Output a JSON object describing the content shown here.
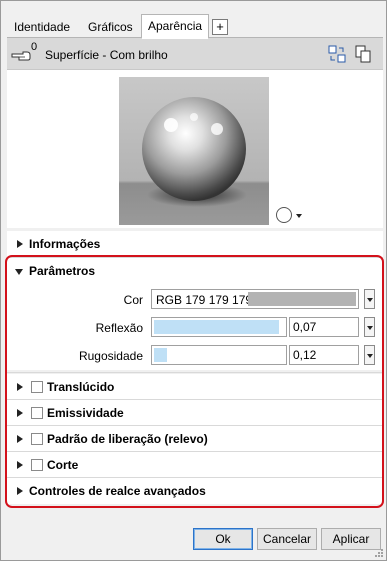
{
  "tabs": [
    {
      "label": "Identidade",
      "active": false
    },
    {
      "label": "Gráficos",
      "active": false
    },
    {
      "label": "Aparência",
      "active": true
    }
  ],
  "tab_add_label": "+",
  "header": {
    "count": "0",
    "title": "Superfície - Com brilho",
    "icons": [
      "hand-icon",
      "replace-asset-icon",
      "duplicate-asset-icon"
    ]
  },
  "preview": {
    "scene_icons": [
      "sphere-scene-icon",
      "chevron-down-icon"
    ]
  },
  "sections": {
    "informacoes": "Informações",
    "parametros": "Parâmetros",
    "translucido": "Translúcido",
    "emissividade": "Emissividade",
    "padrao": "Padrão de liberação (relevo)",
    "corte": "Corte",
    "controles": "Controles de realce avançados"
  },
  "parameters": {
    "cor_label": "Cor",
    "cor_value": "RGB 179 179 179",
    "cor_hex": "#b3b3b3",
    "reflexao_label": "Reflexão",
    "reflexao_value": "0,07",
    "reflexao_fill": 0.95,
    "rugosidade_label": "Rugosidade",
    "rugosidade_value": "0,12",
    "rugosidade_fill": 0.1
  },
  "buttons": {
    "ok": "Ok",
    "cancelar": "Cancelar",
    "aplicar": "Aplicar"
  },
  "colors": {
    "highlight": "#d3111b",
    "accent": "#2c73c9",
    "slider_fill": "#bfe0f6"
  }
}
